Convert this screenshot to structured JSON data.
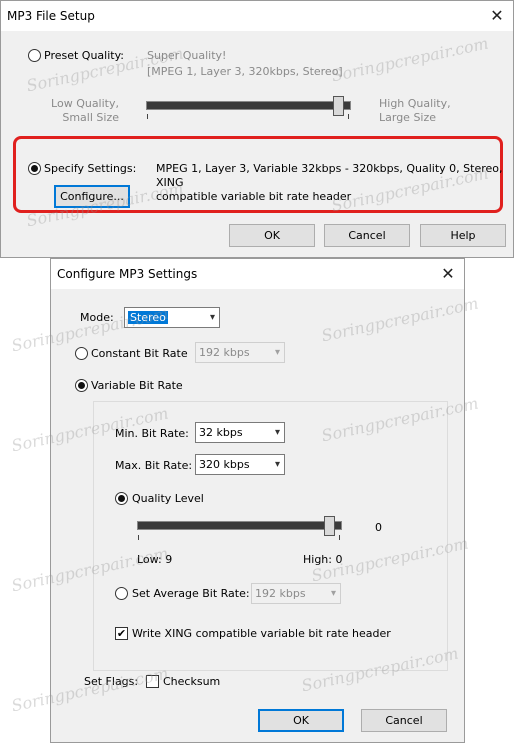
{
  "top_window": {
    "title": "MP3 File Setup",
    "preset_label": "Preset Quality:",
    "preset_name": "Super Quality!",
    "preset_details": "[MPEG 1, Layer 3, 320kbps, Stereo]",
    "low_label_1": "Low Quality,",
    "low_label_2": "Small Size",
    "high_label_1": "High Quality,",
    "high_label_2": "Large Size",
    "specify_label": "Specify Settings:",
    "specify_line_1": "MPEG 1, Layer 3, Variable 32kbps - 320kbps, Quality 0, Stereo, XING",
    "specify_line_2": "compatible variable bit rate header",
    "configure_button": "Configure...",
    "ok_button": "OK",
    "cancel_button": "Cancel",
    "help_button": "Help",
    "preset_slider_level": 0.95
  },
  "config_window": {
    "title": "Configure MP3 Settings",
    "mode_label": "Mode:",
    "mode_value": "Stereo",
    "constant_label": "Constant Bit Rate",
    "constant_value": "192 kbps",
    "variable_label": "Variable Bit Rate",
    "min_label": "Min. Bit Rate:",
    "min_value": "32 kbps",
    "max_label": "Max. Bit Rate:",
    "max_value": "320 kbps",
    "quality_label": "Quality Level",
    "quality_value": "0",
    "quality_low": "Low: 9",
    "quality_high": "High: 0",
    "avg_label": "Set Average Bit Rate:",
    "avg_value": "192 kbps",
    "xing_label": "Write XING compatible variable bit rate header",
    "flags_label": "Set Flags:",
    "checksum_label": "Checksum",
    "ok_button": "OK",
    "cancel_button": "Cancel",
    "quality_slider_level": 1.0
  },
  "watermark": "Soringpcrepair.com",
  "colors": {
    "highlight": "#e0201e",
    "focus": "#0078d7"
  }
}
